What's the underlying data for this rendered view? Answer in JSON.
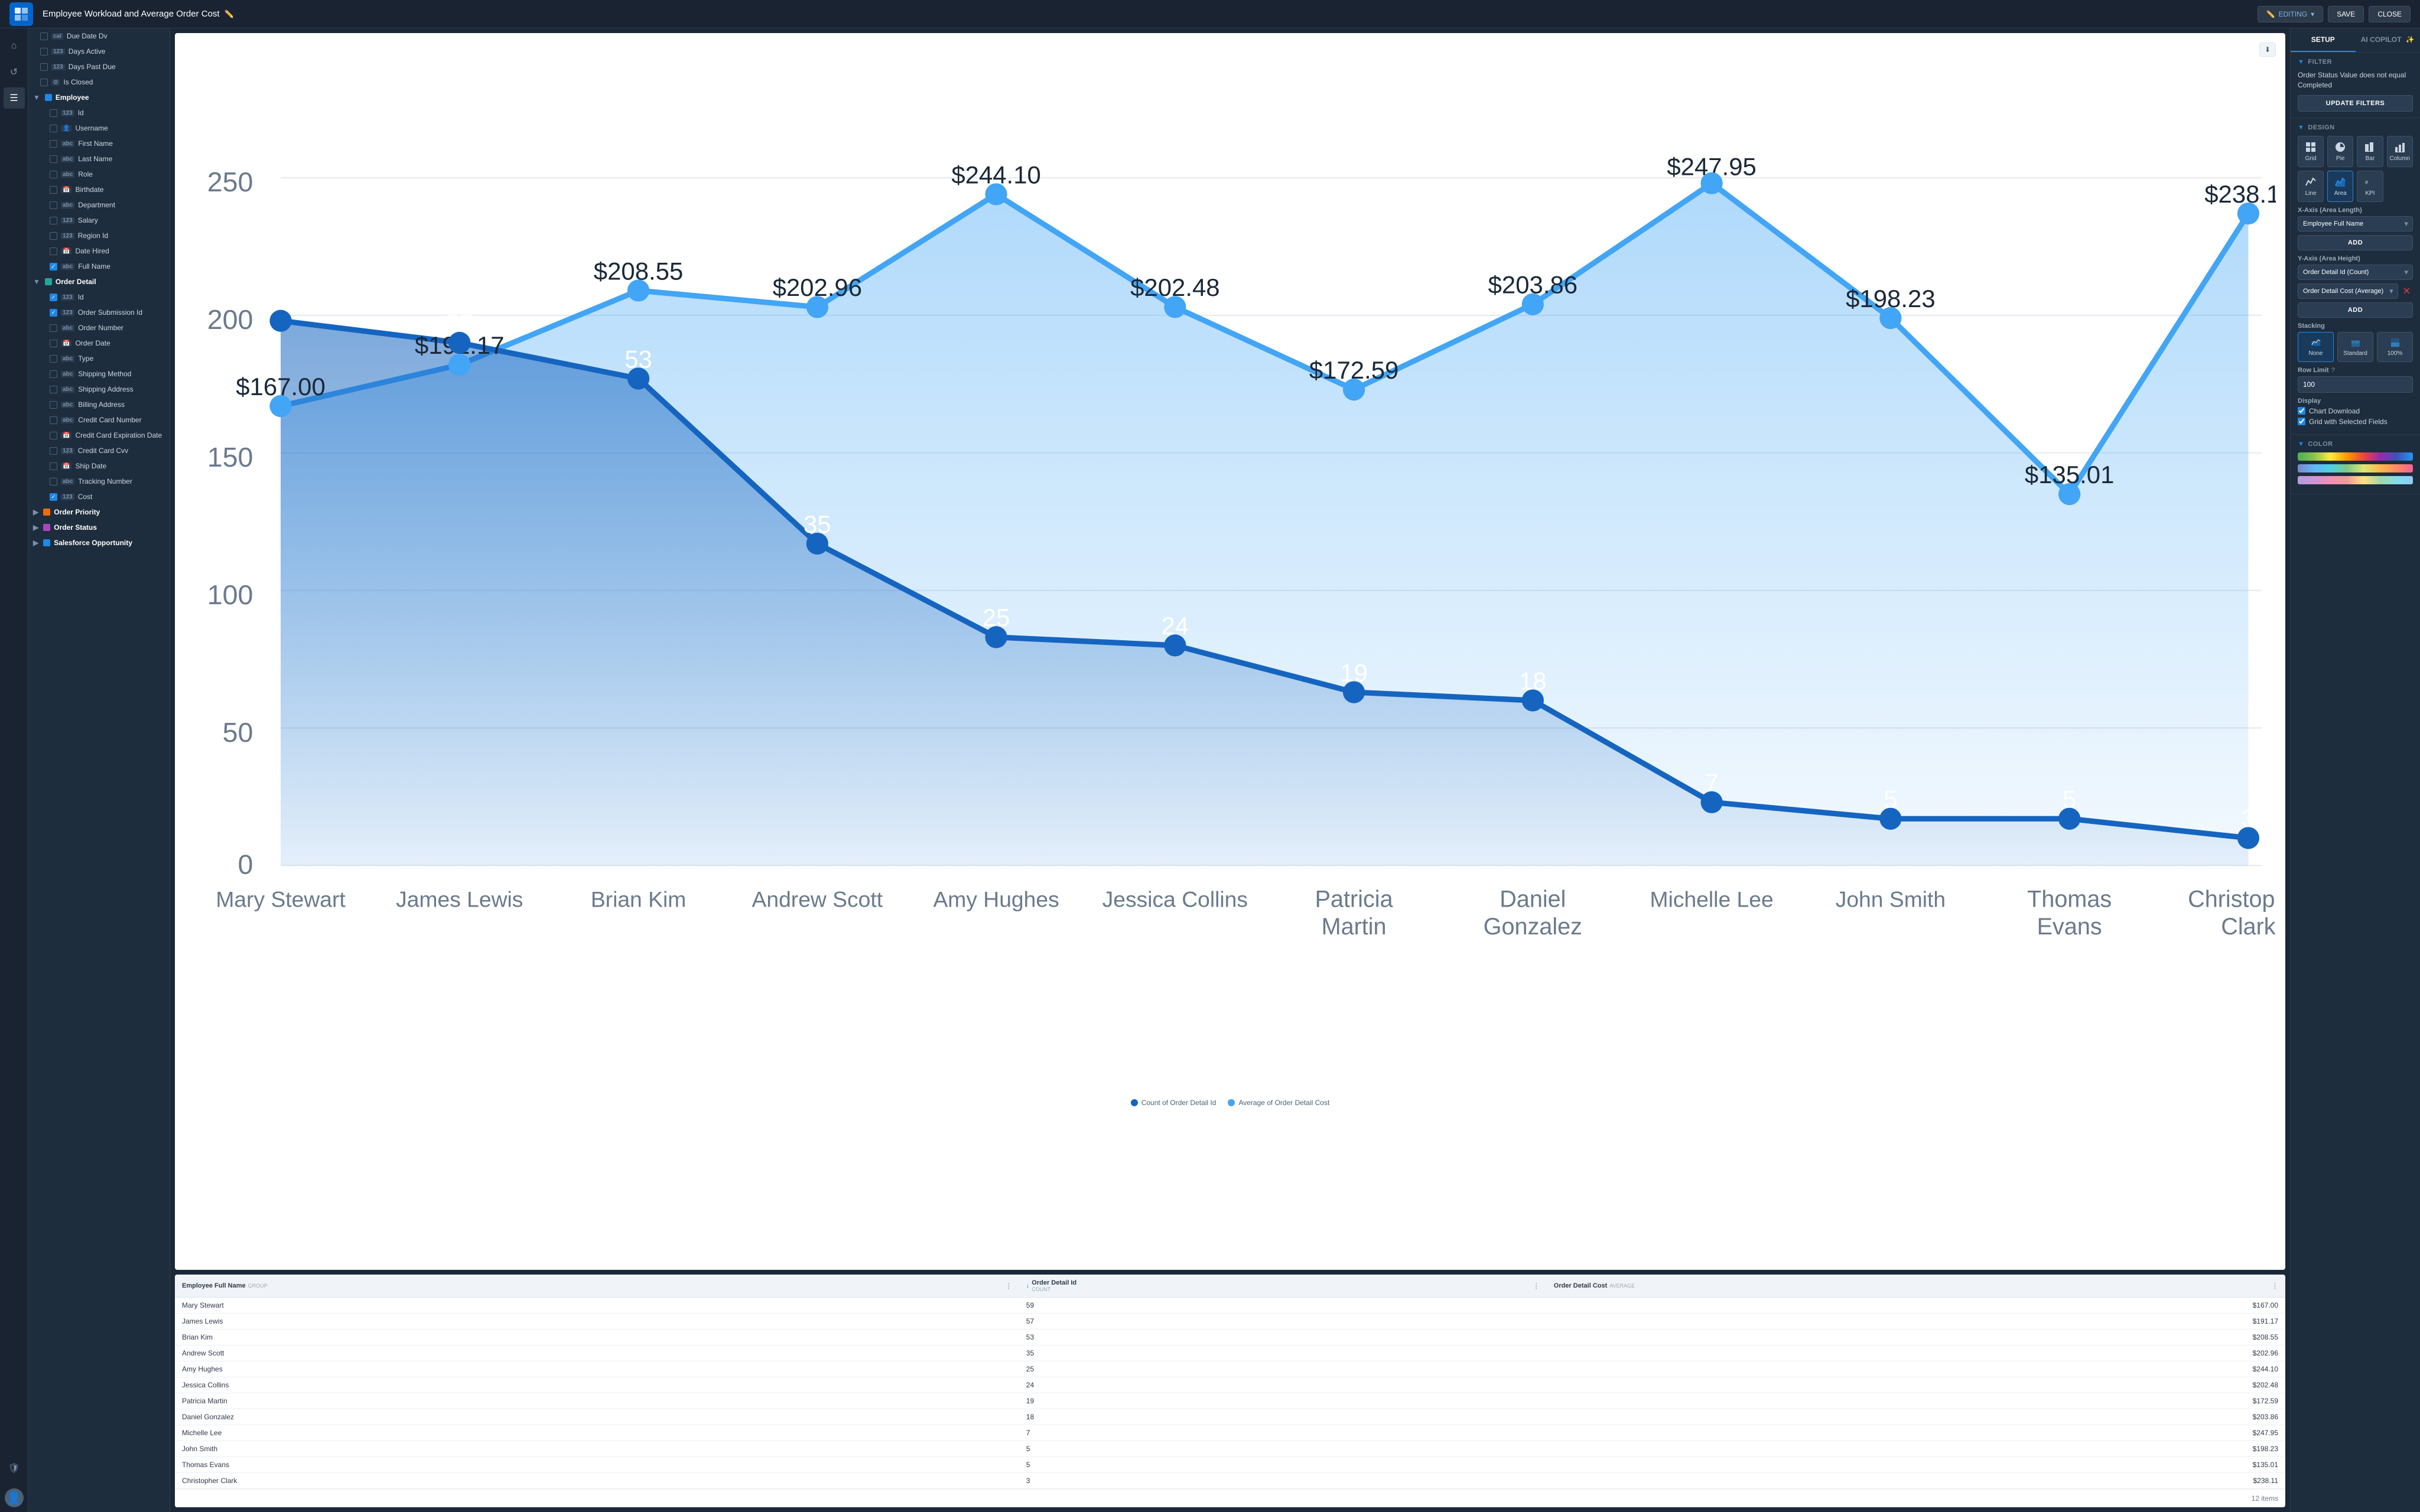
{
  "topbar": {
    "title": "Employee Workload and Average Order Cost",
    "editing_label": "EDITING",
    "save_label": "SAVE",
    "close_label": "CLOSE"
  },
  "sidebar": {
    "groups": [
      {
        "name": "Employee",
        "color": "#1e88e5",
        "items": [
          {
            "label": "Id",
            "type": "123",
            "indent": 2,
            "checked": false
          },
          {
            "label": "Username",
            "type": "user",
            "indent": 2,
            "checked": false
          },
          {
            "label": "First Name",
            "type": "abc",
            "indent": 2,
            "checked": false
          },
          {
            "label": "Last Name",
            "type": "abc",
            "indent": 2,
            "checked": false
          },
          {
            "label": "Role",
            "type": "abc",
            "indent": 2,
            "checked": false
          },
          {
            "label": "Birthdate",
            "type": "cal",
            "indent": 2,
            "checked": false
          },
          {
            "label": "Department",
            "type": "abc",
            "indent": 2,
            "checked": false
          },
          {
            "label": "Salary",
            "type": "123",
            "indent": 2,
            "checked": false
          },
          {
            "label": "Region Id",
            "type": "123",
            "indent": 2,
            "checked": false
          },
          {
            "label": "Date Hired",
            "type": "cal",
            "indent": 2,
            "checked": false
          },
          {
            "label": "Full Name",
            "type": "abc",
            "indent": 2,
            "checked": true
          }
        ]
      },
      {
        "name": "Order Detail",
        "color": "#26a69a",
        "items": [
          {
            "label": "Id",
            "type": "123",
            "indent": 2,
            "checked": true
          },
          {
            "label": "Order Submission Id",
            "type": "123",
            "indent": 2,
            "checked": true
          },
          {
            "label": "Order Number",
            "type": "abc",
            "indent": 2,
            "checked": false
          },
          {
            "label": "Order Date",
            "type": "cal",
            "indent": 2,
            "checked": false
          },
          {
            "label": "Type",
            "type": "abc",
            "indent": 2,
            "checked": false
          },
          {
            "label": "Shipping Method",
            "type": "abc",
            "indent": 2,
            "checked": false
          },
          {
            "label": "Shipping Address",
            "type": "abc",
            "indent": 2,
            "checked": false
          },
          {
            "label": "Billing Address",
            "type": "abc",
            "indent": 2,
            "checked": false
          },
          {
            "label": "Credit Card Number",
            "type": "abc",
            "indent": 2,
            "checked": false
          },
          {
            "label": "Credit Card Expiration Date",
            "type": "cal",
            "indent": 2,
            "checked": false
          },
          {
            "label": "Credit Card Cvv",
            "type": "123",
            "indent": 2,
            "checked": false
          },
          {
            "label": "Ship Date",
            "type": "cal",
            "indent": 2,
            "checked": false
          },
          {
            "label": "Tracking Number",
            "type": "abc",
            "indent": 2,
            "checked": false
          },
          {
            "label": "Cost",
            "type": "123",
            "indent": 2,
            "checked": true
          }
        ]
      },
      {
        "name": "Order Priority",
        "color": "#ef6c00",
        "items": []
      },
      {
        "name": "Order Status",
        "color": "#ab47bc",
        "items": []
      },
      {
        "name": "Salesforce Opportunity",
        "color": "#1e88e5",
        "items": []
      }
    ],
    "top_items": [
      {
        "label": "Due Date Dv",
        "type": "cal",
        "checked": false
      },
      {
        "label": "Days Active",
        "type": "123",
        "checked": false
      },
      {
        "label": "Days Past Due",
        "type": "123",
        "checked": false
      },
      {
        "label": "Is Closed",
        "type": "bool",
        "checked": false
      }
    ]
  },
  "chart": {
    "y_max": 250,
    "y_labels": [
      "0",
      "50",
      "100",
      "150",
      "200",
      "250"
    ],
    "data_points": [
      {
        "name": "Mary Stewart",
        "count": 59,
        "avg": 167.0
      },
      {
        "name": "James Lewis",
        "count": 57,
        "avg": 191.17
      },
      {
        "name": "Brian Kim",
        "count": 53,
        "avg": 208.55
      },
      {
        "name": "Andrew Scott",
        "count": 35,
        "avg": 202.96
      },
      {
        "name": "Amy Hughes",
        "count": 25,
        "avg": 244.1
      },
      {
        "name": "Jessica Collins",
        "count": 24,
        "avg": 202.48
      },
      {
        "name": "Patricia Martin",
        "count": 19,
        "avg": 172.59
      },
      {
        "name": "Daniel Gonzalez",
        "count": 18,
        "avg": 203.86
      },
      {
        "name": "Michelle Lee",
        "count": 7,
        "avg": 247.95
      },
      {
        "name": "John Smith",
        "count": 5,
        "avg": 198.23
      },
      {
        "name": "Thomas Evans",
        "count": 5,
        "avg": 135.01
      },
      {
        "name": "Christopher Clark",
        "count": 3,
        "avg": 238.11
      }
    ],
    "legend": [
      {
        "label": "Count of Order Detail Id",
        "color": "#1565c0"
      },
      {
        "label": "Average of Order Detail Cost",
        "color": "#42a5f5"
      }
    ]
  },
  "table": {
    "columns": [
      {
        "label": "Employee Full Name",
        "sublabel": "GROUP"
      },
      {
        "label": "Order Detail Id",
        "sublabel": "COUNT",
        "sortable": true
      },
      {
        "label": "Order Detail Cost",
        "sublabel": "AVERAGE"
      }
    ],
    "rows": [
      {
        "name": "Mary Stewart",
        "count": 59,
        "cost": "$167.00"
      },
      {
        "name": "James Lewis",
        "count": 57,
        "cost": "$191.17"
      },
      {
        "name": "Brian Kim",
        "count": 53,
        "cost": "$208.55"
      },
      {
        "name": "Andrew Scott",
        "count": 35,
        "cost": "$202.96"
      },
      {
        "name": "Amy Hughes",
        "count": 25,
        "cost": "$244.10"
      },
      {
        "name": "Jessica Collins",
        "count": 24,
        "cost": "$202.48"
      },
      {
        "name": "Patricia Martin",
        "count": 19,
        "cost": "$172.59"
      },
      {
        "name": "Daniel Gonzalez",
        "count": 18,
        "cost": "$203.86"
      },
      {
        "name": "Michelle Lee",
        "count": 7,
        "cost": "$247.95"
      },
      {
        "name": "John Smith",
        "count": 5,
        "cost": "$198.23"
      },
      {
        "name": "Thomas Evans",
        "count": 5,
        "cost": "$135.01"
      },
      {
        "name": "Christopher Clark",
        "count": 3,
        "cost": "$238.11"
      }
    ],
    "footer": "12 items"
  },
  "right_panel": {
    "tabs": [
      "SETUP",
      "AI COPILOT"
    ],
    "filter": {
      "label": "FILTER",
      "text": "Order Status Value does not equal Completed",
      "update_btn": "UPDATE FILTERS"
    },
    "design": {
      "label": "DESIGN",
      "types": [
        "Grid",
        "Pie",
        "Bar",
        "Column",
        "Line",
        "Area",
        "KPI"
      ],
      "active_type": "Area",
      "x_axis_label": "X-Axis (Area Length)",
      "x_axis_value": "Employee Full Name",
      "add_label": "ADD",
      "y_axis_label": "Y-Axis (Area Height)",
      "y_axis_values": [
        "Order Detail Id (Count)",
        "Order Detail Cost (Average)"
      ],
      "stacking_label": "Stacking",
      "stacking_options": [
        "None",
        "Standard",
        "100%"
      ],
      "active_stacking": "None",
      "row_limit_label": "Row Limit",
      "row_limit_value": "100",
      "display_label": "Display",
      "display_items": [
        "Chart Download",
        "Grid with Selected Fields"
      ]
    },
    "color": {
      "label": "COLOR"
    }
  }
}
